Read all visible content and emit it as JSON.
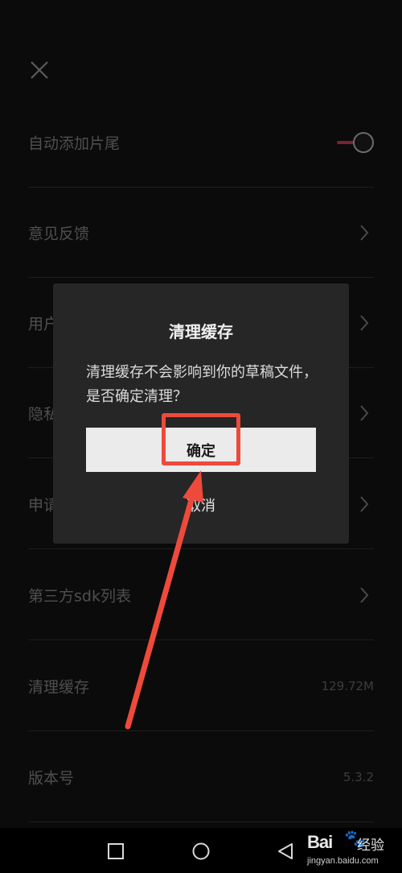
{
  "settings": {
    "items": [
      {
        "label": "自动添加片尾"
      },
      {
        "label": "意见反馈"
      },
      {
        "label": "用户"
      },
      {
        "label": "隐私"
      },
      {
        "label": "申请"
      },
      {
        "label": "第三方sdk列表"
      },
      {
        "label": "清理缓存",
        "value": "129.72M"
      },
      {
        "label": "版本号",
        "value": "5.3.2"
      }
    ]
  },
  "dialog": {
    "title": "清理缓存",
    "message": "清理缓存不会影响到你的草稿文件，是否确定清理？",
    "confirm_label": "确定",
    "cancel_label": "取消"
  },
  "watermark": {
    "brand": "Bai",
    "paw_glyph": "🐾",
    "jingyan": "经验",
    "url": "jingyan.baidu.com"
  },
  "colors": {
    "accent_red": "#ee4a3c",
    "toggle_track": "#7a2233"
  },
  "icons": [
    "close-icon",
    "chevron-right-icon",
    "square-nav-icon",
    "circle-nav-icon",
    "triangle-back-icon"
  ]
}
